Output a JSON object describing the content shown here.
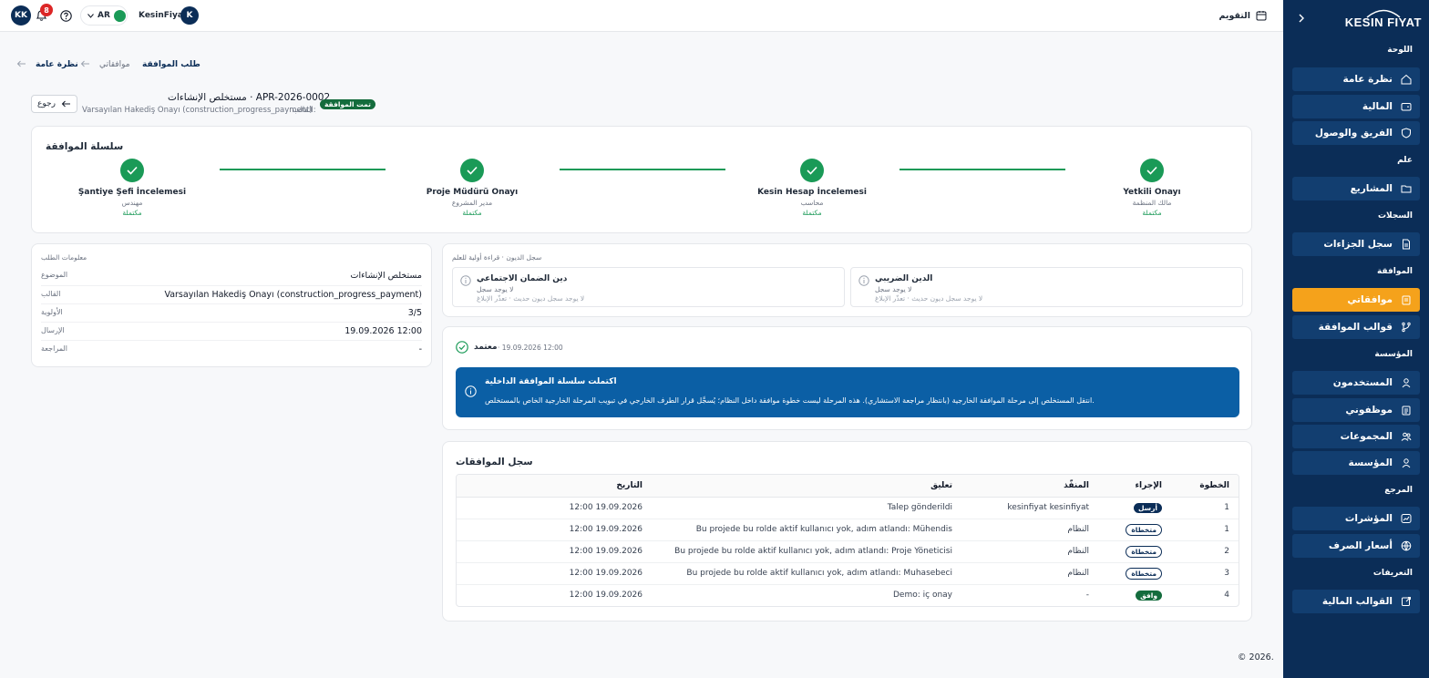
{
  "sidebar": {
    "logo": "KESIN FIYAT",
    "sections": {
      "panel": "اللوحة",
      "general": "علم",
      "records": "السجلات",
      "approval": "الموافقة",
      "org": "المؤسسة",
      "reference": "المرجع",
      "definitions": "التعريفات"
    },
    "items": {
      "overview": "نظرة عامة",
      "finance": "المالية",
      "team": "الفريق والوصول",
      "projects": "المشاريع",
      "penalties": "سجل الجزاءات",
      "myapprovals": "موافقاتي",
      "approval_templates": "قوالب الموافقة",
      "users": "المستخدمون",
      "employees": "موظفوني",
      "groups": "المجموعات",
      "organization": "المؤسسة",
      "indicators": "المؤشرات",
      "exchange": "أسعار الصرف",
      "financial_templates": "القوالب المالية"
    }
  },
  "topbar": {
    "user_initials": "KK",
    "notif_count": "8",
    "lang": "AR",
    "org_name": "KesinFiyat",
    "org_initial": "K",
    "calendar": "التقويم"
  },
  "breadcrumb": {
    "home": "نظرة عامة",
    "mid": "موافقاتي",
    "current": "طلب الموافقة"
  },
  "header": {
    "back": "رجوع",
    "status": "تمت الموافقة",
    "title": "مستخلص الإنشاءات · APR-2026-0002",
    "template_label": "القالب:",
    "template_value": "Varsayılan Hakediş Onayı (construction_progress_payment)"
  },
  "chain": {
    "title": "سلسلة الموافقة",
    "steps": [
      {
        "name": "Yetkili Onayı",
        "role": "مالك المنظمة",
        "status": "مكتملة"
      },
      {
        "name": "Kesin Hesap İncelemesi",
        "role": "محاسب",
        "status": "مكتملة"
      },
      {
        "name": "Proje Müdürü Onayı",
        "role": "مدير المشروع",
        "status": "مكتملة"
      },
      {
        "name": "Şantiye Şefi İncelemesi",
        "role": "مهندس",
        "status": "مكتملة"
      }
    ]
  },
  "info": {
    "title": "معلومات الطلب",
    "rows": [
      {
        "label": "الموضوع",
        "value": "مستخلص الإنشاءات"
      },
      {
        "label": "القالب",
        "value": "Varsayılan Hakediş Onayı (construction_progress_payment)"
      },
      {
        "label": "الأولوية",
        "value": "3/5"
      },
      {
        "label": "الإرسال",
        "value": "19.09.2026 12:00"
      },
      {
        "label": "المراجعة",
        "value": "-"
      }
    ]
  },
  "debt": {
    "title": "سجل الديون · قراءة أولية للعلم",
    "tax": {
      "title": "الدين الضريبي",
      "sub": "لا يوجد سجل",
      "note": "لا يوجد سجل ديون حديث · تعذّر الإبلاغ"
    },
    "sgk": {
      "title": "دين الضمان الاجتماعي",
      "sub": "لا يوجد سجل",
      "note": "لا يوجد سجل ديون حديث · تعذّر الإبلاغ"
    }
  },
  "decision": {
    "status": "معتمد",
    "date": "· 19.09.2026 12:00",
    "alert_title": "اكتملت سلسلة الموافقة الداخلية",
    "alert_body": "انتقل المستخلص إلى مرحلة الموافقة الخارجية (بانتظار مراجعة الاستشاري). هذه المرحلة ليست خطوة موافقة داخل النظام؛ يُسجَّل قرار الطرف الخارجي في تبويب المرحلة الخارجية الخاص بالمستخلص."
  },
  "log": {
    "title": "سجل الموافقات",
    "headers": [
      "الخطوة",
      "الإجراء",
      "المنفّذ",
      "تعليق",
      "التاريخ"
    ],
    "rows": [
      [
        "1",
        "أرسل",
        "kesinfiyat kesinfiyat",
        "Talep gönderildi",
        "19.09.2026 12:00"
      ],
      [
        "1",
        "متخطاة",
        "النظام",
        "Bu projede bu rolde aktif kullanıcı yok, adım atlandı: Mühendis",
        "19.09.2026 12:00"
      ],
      [
        "2",
        "متخطاة",
        "النظام",
        "Bu projede bu rolde aktif kullanıcı yok, adım atlandı: Proje Yöneticisi",
        "19.09.2026 12:00"
      ],
      [
        "3",
        "متخطاة",
        "النظام",
        "Bu projede bu rolde aktif kullanıcı yok, adım atlandı: Muhasebeci",
        "19.09.2026 12:00"
      ],
      [
        "4",
        "وافق",
        "-",
        "Demo: iç onay",
        "19.09.2026 12:00"
      ]
    ]
  },
  "footer": "© 2026."
}
